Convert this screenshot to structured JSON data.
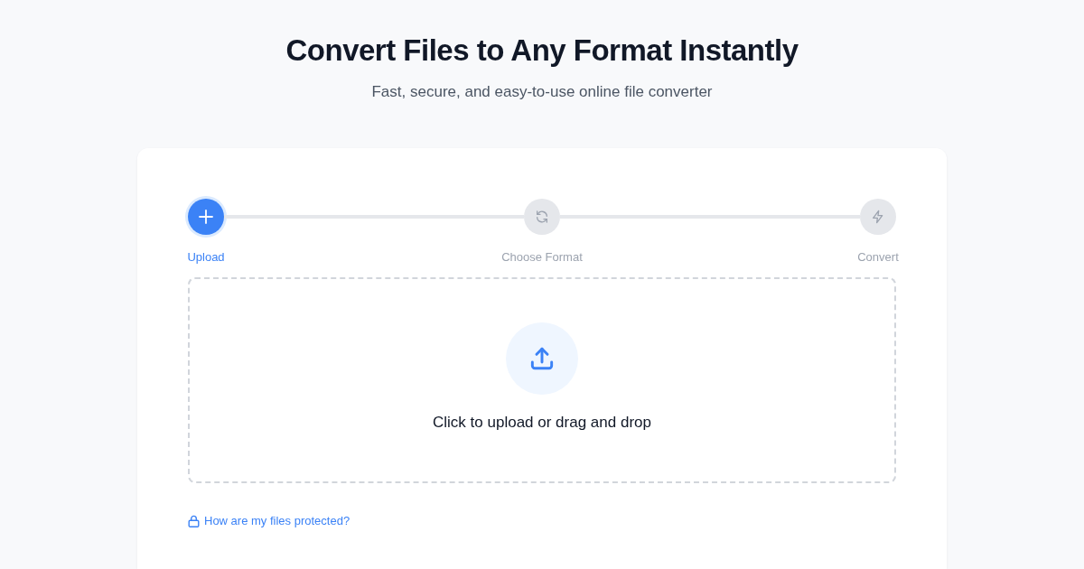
{
  "header": {
    "title": "Convert Files to Any Format Instantly",
    "subtitle": "Fast, secure, and easy-to-use online file converter"
  },
  "steps": [
    {
      "label": "Upload",
      "active": true
    },
    {
      "label": "Choose Format",
      "active": false
    },
    {
      "label": "Convert",
      "active": false
    }
  ],
  "dropzone": {
    "text": "Click to upload or drag and drop"
  },
  "security_link": {
    "text": "How are my files protected?"
  }
}
